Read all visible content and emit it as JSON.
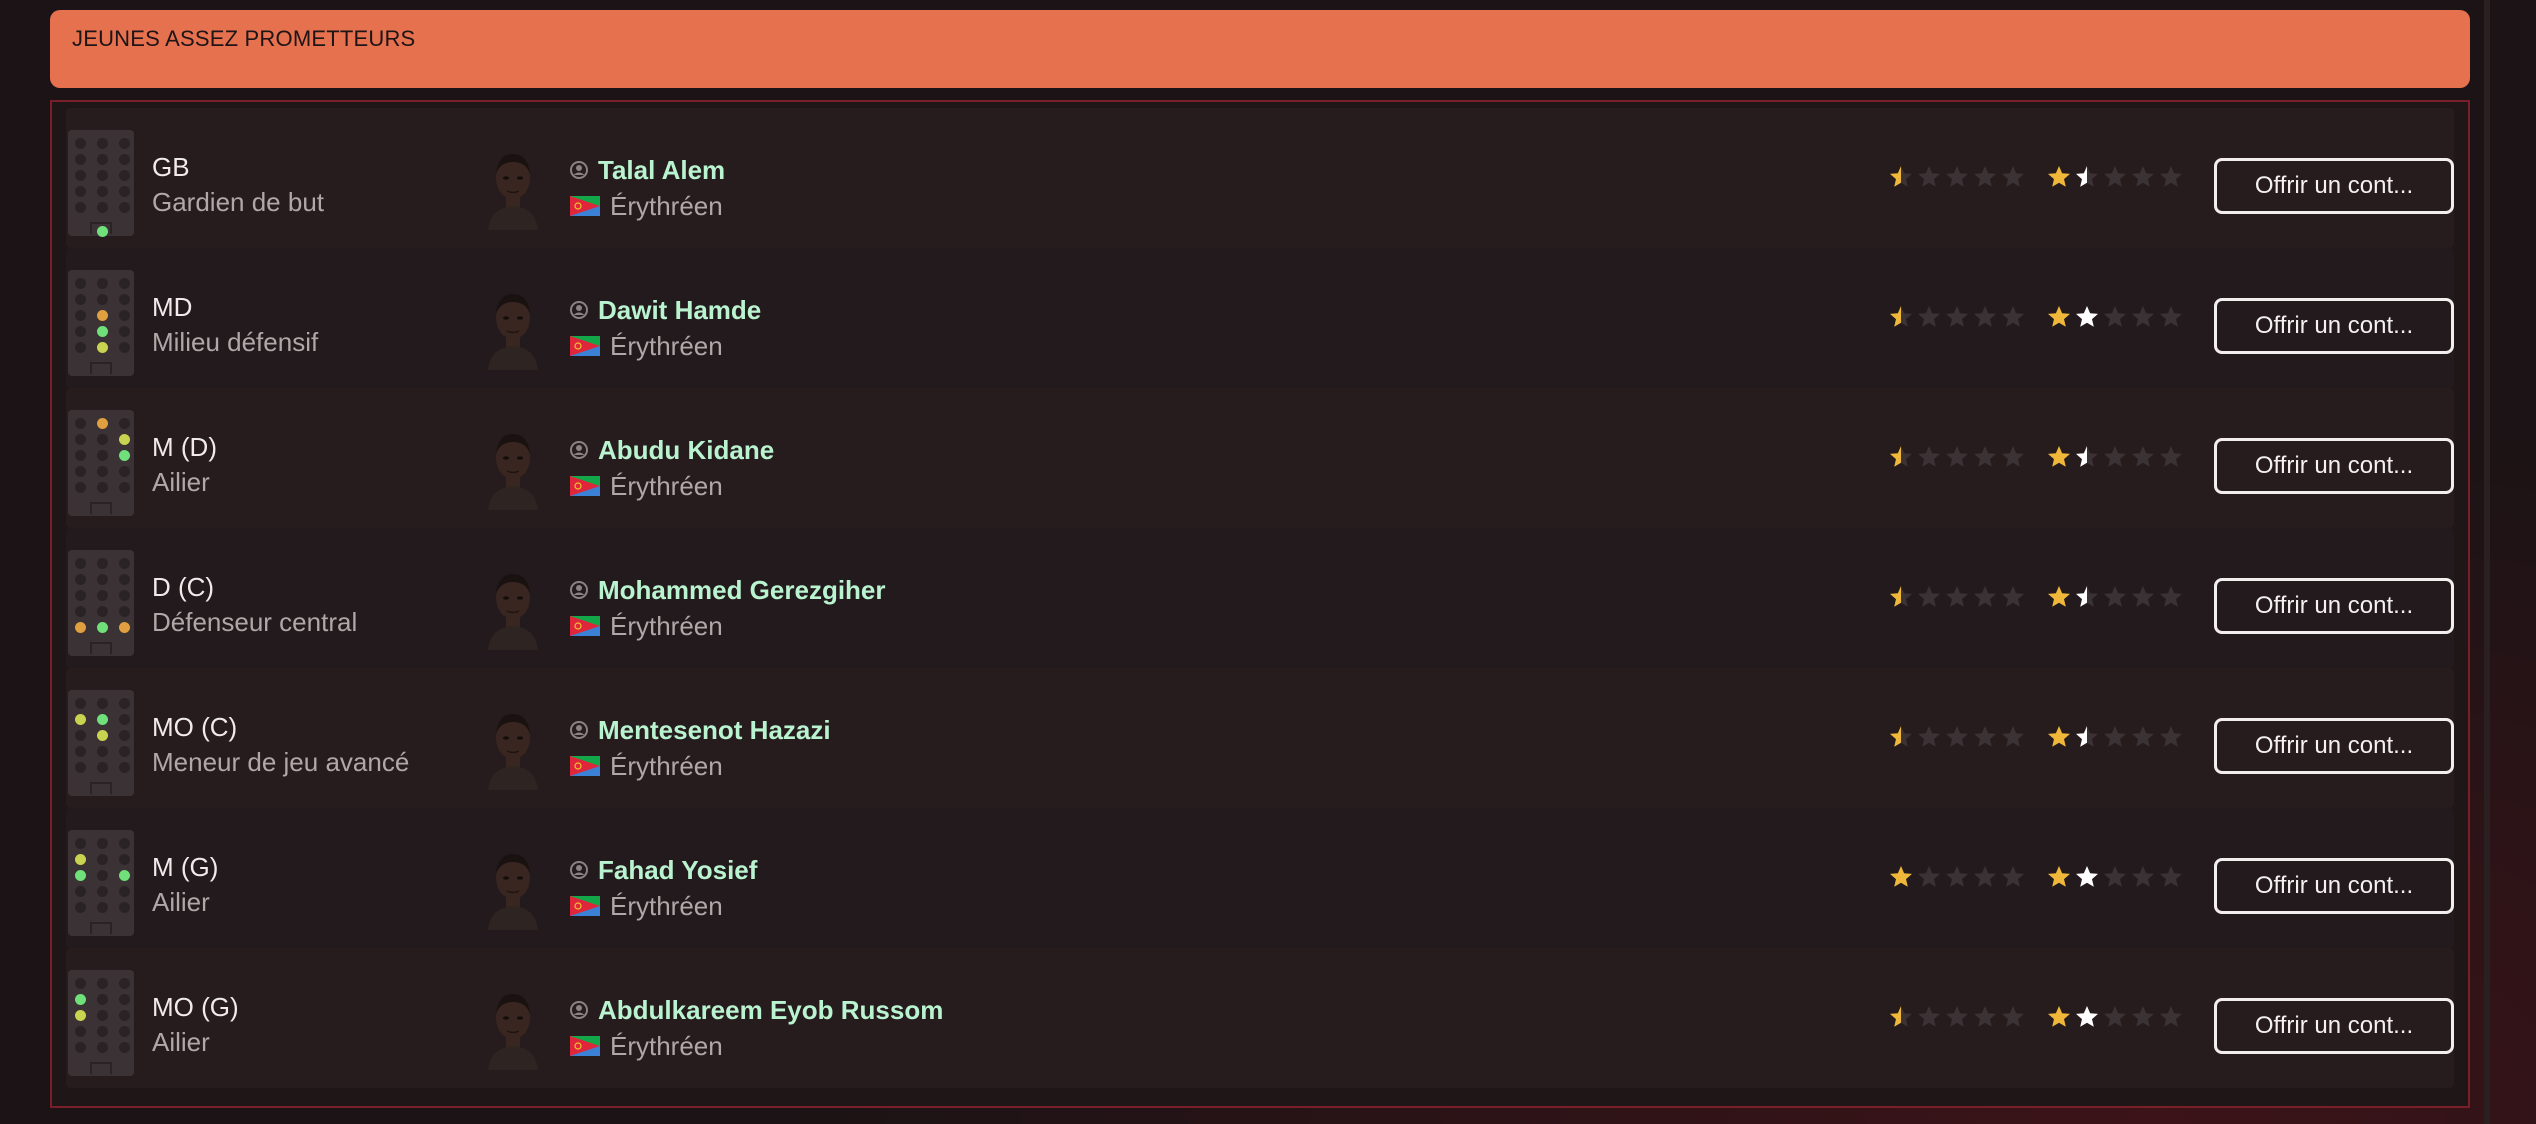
{
  "section": {
    "title": "JEUNES ASSEZ PROMETTEURS"
  },
  "colors": {
    "header": "#e5714f",
    "name": "#b9f3cf",
    "star_gold": "#f0b83a",
    "star_white": "#ffffff",
    "star_empty": "#3a3234"
  },
  "offer_label": "Offrir un cont...",
  "players": [
    {
      "pos_code": "GB",
      "pos_name": "Gardien de but",
      "name": "Talal Alem",
      "nationality": "Érythréen",
      "current_ability": 0.5,
      "potential": 1.5,
      "pitch": [
        [
          29,
          96,
          "g"
        ]
      ]
    },
    {
      "pos_code": "MD",
      "pos_name": "Milieu défensif",
      "name": "Dawit Hamde",
      "nationality": "Érythréen",
      "current_ability": 0.5,
      "potential": 2,
      "pitch": [
        [
          29,
          40,
          "o"
        ],
        [
          29,
          56,
          "g"
        ],
        [
          29,
          72,
          "y"
        ]
      ]
    },
    {
      "pos_code": "M (D)",
      "pos_name": "Ailier",
      "name": "Abudu Kidane",
      "nationality": "Érythréen",
      "current_ability": 0.5,
      "potential": 1.5,
      "pitch": [
        [
          29,
          8,
          "o"
        ],
        [
          51,
          24,
          "y"
        ],
        [
          51,
          40,
          "g"
        ]
      ]
    },
    {
      "pos_code": "D (C)",
      "pos_name": "Défenseur central",
      "name": "Mohammed Gerezgiher",
      "nationality": "Érythréen",
      "current_ability": 0.5,
      "potential": 1.5,
      "pitch": [
        [
          7,
          72,
          "o"
        ],
        [
          29,
          72,
          "g"
        ],
        [
          51,
          72,
          "o"
        ]
      ]
    },
    {
      "pos_code": "MO (C)",
      "pos_name": "Meneur de jeu avancé",
      "name": "Mentesenot Hazazi",
      "nationality": "Érythréen",
      "current_ability": 0.5,
      "potential": 1.5,
      "pitch": [
        [
          7,
          24,
          "y"
        ],
        [
          29,
          24,
          "g"
        ],
        [
          29,
          40,
          "y"
        ]
      ]
    },
    {
      "pos_code": "M (G)",
      "pos_name": "Ailier",
      "name": "Fahad Yosief",
      "nationality": "Érythréen",
      "current_ability": 1,
      "potential": 2,
      "pitch": [
        [
          7,
          24,
          "y"
        ],
        [
          7,
          40,
          "g"
        ],
        [
          51,
          40,
          "g"
        ]
      ]
    },
    {
      "pos_code": "MO (G)",
      "pos_name": "Ailier",
      "name": "Abdulkareem Eyob Russom",
      "nationality": "Érythréen",
      "current_ability": 0.5,
      "potential": 2,
      "pitch": [
        [
          7,
          24,
          "g"
        ],
        [
          7,
          40,
          "y"
        ]
      ]
    }
  ]
}
